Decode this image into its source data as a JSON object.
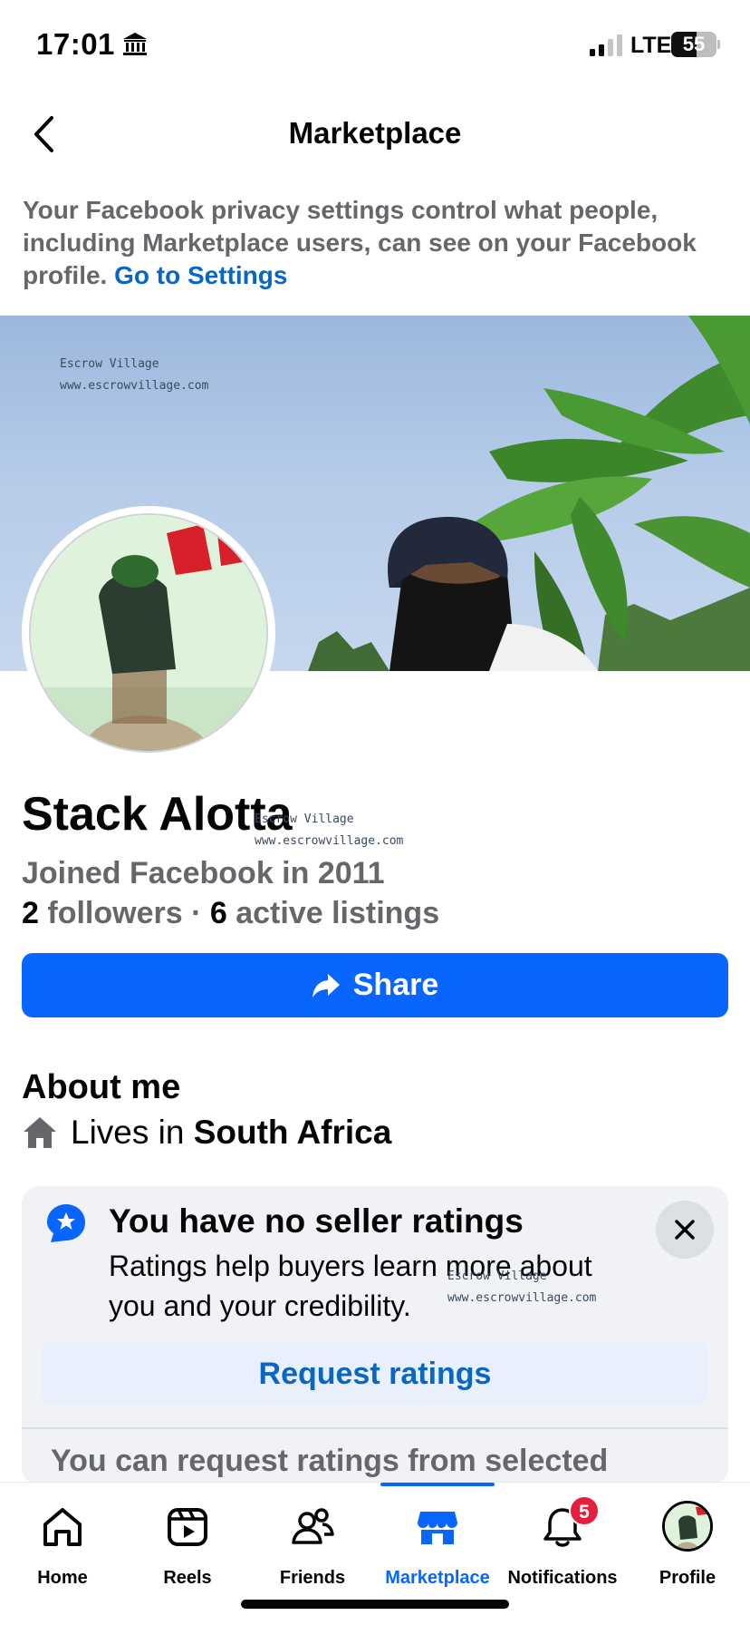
{
  "status_bar": {
    "time": "17:01",
    "network": "LTE",
    "battery_level": "55",
    "battery_fraction": 0.55,
    "bank_icon": "bank-icon",
    "signal_icon": "signal-bars-icon"
  },
  "header": {
    "title": "Marketplace",
    "back_icon": "chevron-left-icon"
  },
  "privacy": {
    "text": "Your Facebook privacy settings control what people, including Marketplace users, can see on your Facebook profile.",
    "link": "Go to Settings"
  },
  "watermark": {
    "name": "Escrow Village",
    "url": "www.escrowvillage.com"
  },
  "profile": {
    "name": "Stack Alotta",
    "joined": "Joined Facebook in 2011",
    "followers_count": "2",
    "followers_label": "followers",
    "separator": "·",
    "listings_count": "6",
    "listings_label": "active listings"
  },
  "share": {
    "label": "Share",
    "icon": "share-arrow-icon"
  },
  "about": {
    "title": "About me",
    "lives_prefix": "Lives in",
    "location": "South Africa",
    "icon": "house-icon"
  },
  "ratings_card": {
    "title": "You have no seller ratings",
    "body": "Ratings help buyers learn more about you and your credibility.",
    "button": "Request ratings",
    "more": "You can request ratings from selected",
    "badge_icon": "star-badge-icon",
    "close_icon": "close-icon"
  },
  "bottom_nav": {
    "items": [
      {
        "label": "Home",
        "icon": "home-icon"
      },
      {
        "label": "Reels",
        "icon": "reels-icon"
      },
      {
        "label": "Friends",
        "icon": "friends-icon"
      },
      {
        "label": "Marketplace",
        "icon": "marketplace-icon",
        "active": true
      },
      {
        "label": "Notifications",
        "icon": "bell-icon",
        "badge": "5"
      },
      {
        "label": "Profile",
        "icon": "profile-avatar"
      }
    ]
  },
  "colors": {
    "accent": "#0866ff",
    "link": "#0a66c2",
    "secondary_text": "#65676b",
    "badge": "#e41e3f"
  }
}
